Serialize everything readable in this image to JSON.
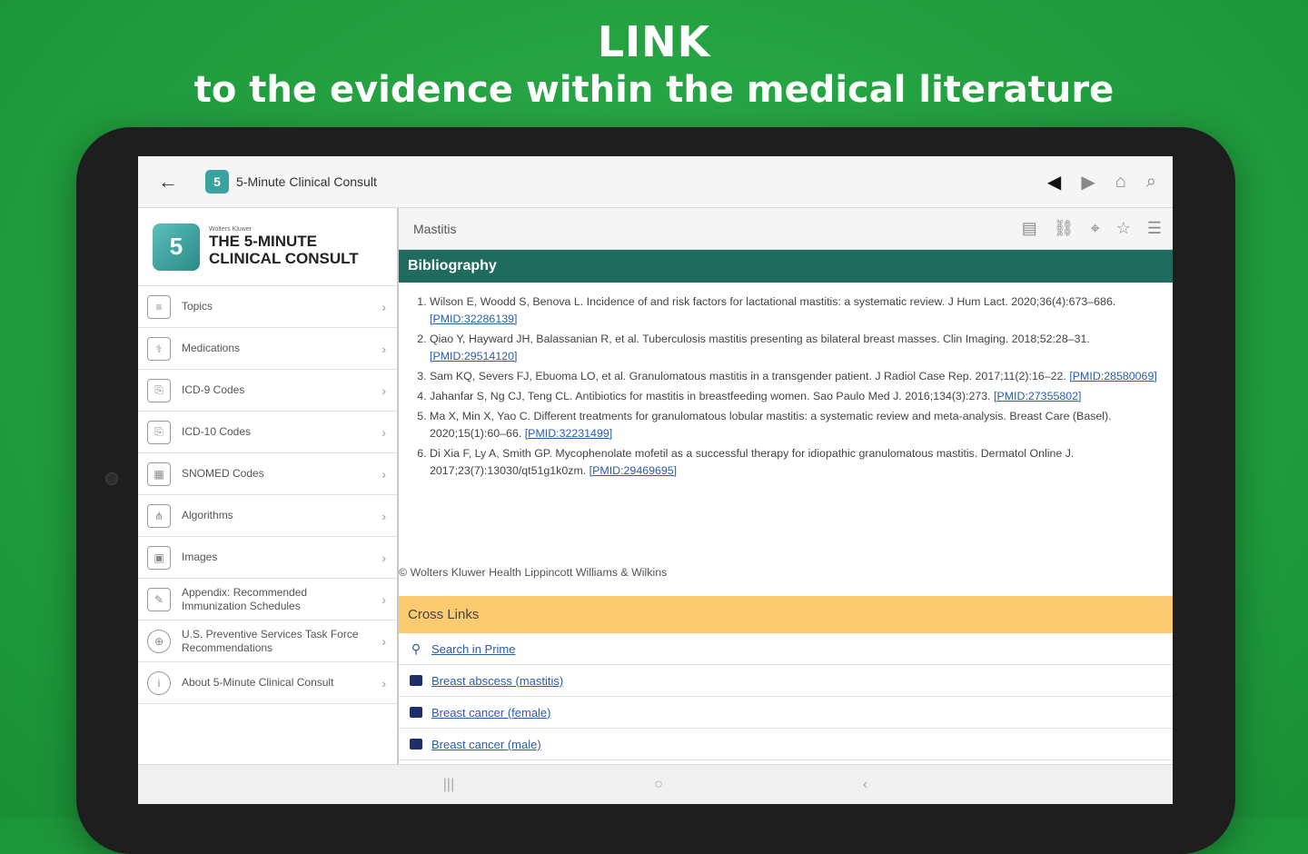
{
  "promo": {
    "headline": "LINK",
    "subheadline": "to the evidence within the medical literature"
  },
  "appbar": {
    "back_icon": "←",
    "app_icon_glyph": "5",
    "title": "5-Minute Clinical Consult",
    "prev_glyph": "◀",
    "next_glyph": "▶",
    "home_glyph": "⌂",
    "search_glyph": "⌕"
  },
  "sidebar": {
    "brand_publisher": "Wolters Kluwer",
    "brand_name": "THE 5-MINUTE CLINICAL CONSULT",
    "brand_glyph": "5",
    "items": [
      {
        "label": "Topics",
        "glyph": "≡"
      },
      {
        "label": "Medications",
        "glyph": "⚕"
      },
      {
        "label": "ICD-9 Codes",
        "glyph": "⎘"
      },
      {
        "label": "ICD-10 Codes",
        "glyph": "⎘"
      },
      {
        "label": "SNOMED Codes",
        "glyph": "▦"
      },
      {
        "label": "Algorithms",
        "glyph": "⋔"
      },
      {
        "label": "Images",
        "glyph": "▣"
      },
      {
        "label": "Appendix: Recommended Immunization Schedules",
        "glyph": "✎"
      },
      {
        "label": "U.S. Preventive Services Task Force Recommendations",
        "glyph": "⊕"
      },
      {
        "label": "About 5-Minute Clinical Consult",
        "glyph": "i"
      }
    ],
    "chevron": "›"
  },
  "main": {
    "topic": "Mastitis",
    "tool_glyphs": [
      "▤",
      "⛓",
      "⌖",
      "☆",
      "☰"
    ],
    "section_title": "Bibliography",
    "references": [
      {
        "text": "Wilson E, Woodd S, Benova L. Incidence of and risk factors for lactational mastitis: a systematic review. J Hum Lact. 2020;36(4):673–686.",
        "pmid": "[PMID:32286139]"
      },
      {
        "text": "Qiao Y, Hayward JH, Balassanian R, et al. Tuberculosis mastitis presenting as bilateral breast masses. Clin Imaging. 2018;52:28–31.",
        "pmid": "[PMID:29514120]"
      },
      {
        "text": "Sam KQ, Severs FJ, Ebuoma LO, et al. Granulomatous mastitis in a transgender patient. J Radiol Case Rep. 2017;11(2):16–22.",
        "pmid": "[PMID:28580069]"
      },
      {
        "text": "Jahanfar S, Ng CJ, Teng CL. Antibiotics for mastitis in breastfeeding women. Sao Paulo Med J. 2016;134(3):273.",
        "pmid": "[PMID:27355802]"
      },
      {
        "text": "Ma X, Min X, Yao C. Different treatments for granulomatous lobular mastitis: a systematic review and meta-analysis. Breast Care (Basel). 2020;15(1):60–66.",
        "pmid": "[PMID:32231499]"
      },
      {
        "text": "Di Xia F, Ly A, Smith GP. Mycophenolate mofetil as a successful therapy for idiopathic granulomatous mastitis. Dermatol Online J. 2017;23(7):13030/qt51g1k0zm.",
        "pmid": "[PMID:29469695]"
      }
    ],
    "copyright": "© Wolters Kluwer Health Lippincott Williams & Wilkins",
    "cross_links_title": "Cross Links",
    "cross_links": [
      {
        "label": "Search in Prime",
        "icon": "search"
      },
      {
        "label": "Breast abscess (mastitis)",
        "icon": "book"
      },
      {
        "label": "Breast cancer (female)",
        "icon": "book"
      },
      {
        "label": "Breast cancer (male)",
        "icon": "book"
      }
    ]
  },
  "system_nav": {
    "recents_glyph": "|||",
    "home_glyph": "○",
    "back_glyph": "‹"
  }
}
